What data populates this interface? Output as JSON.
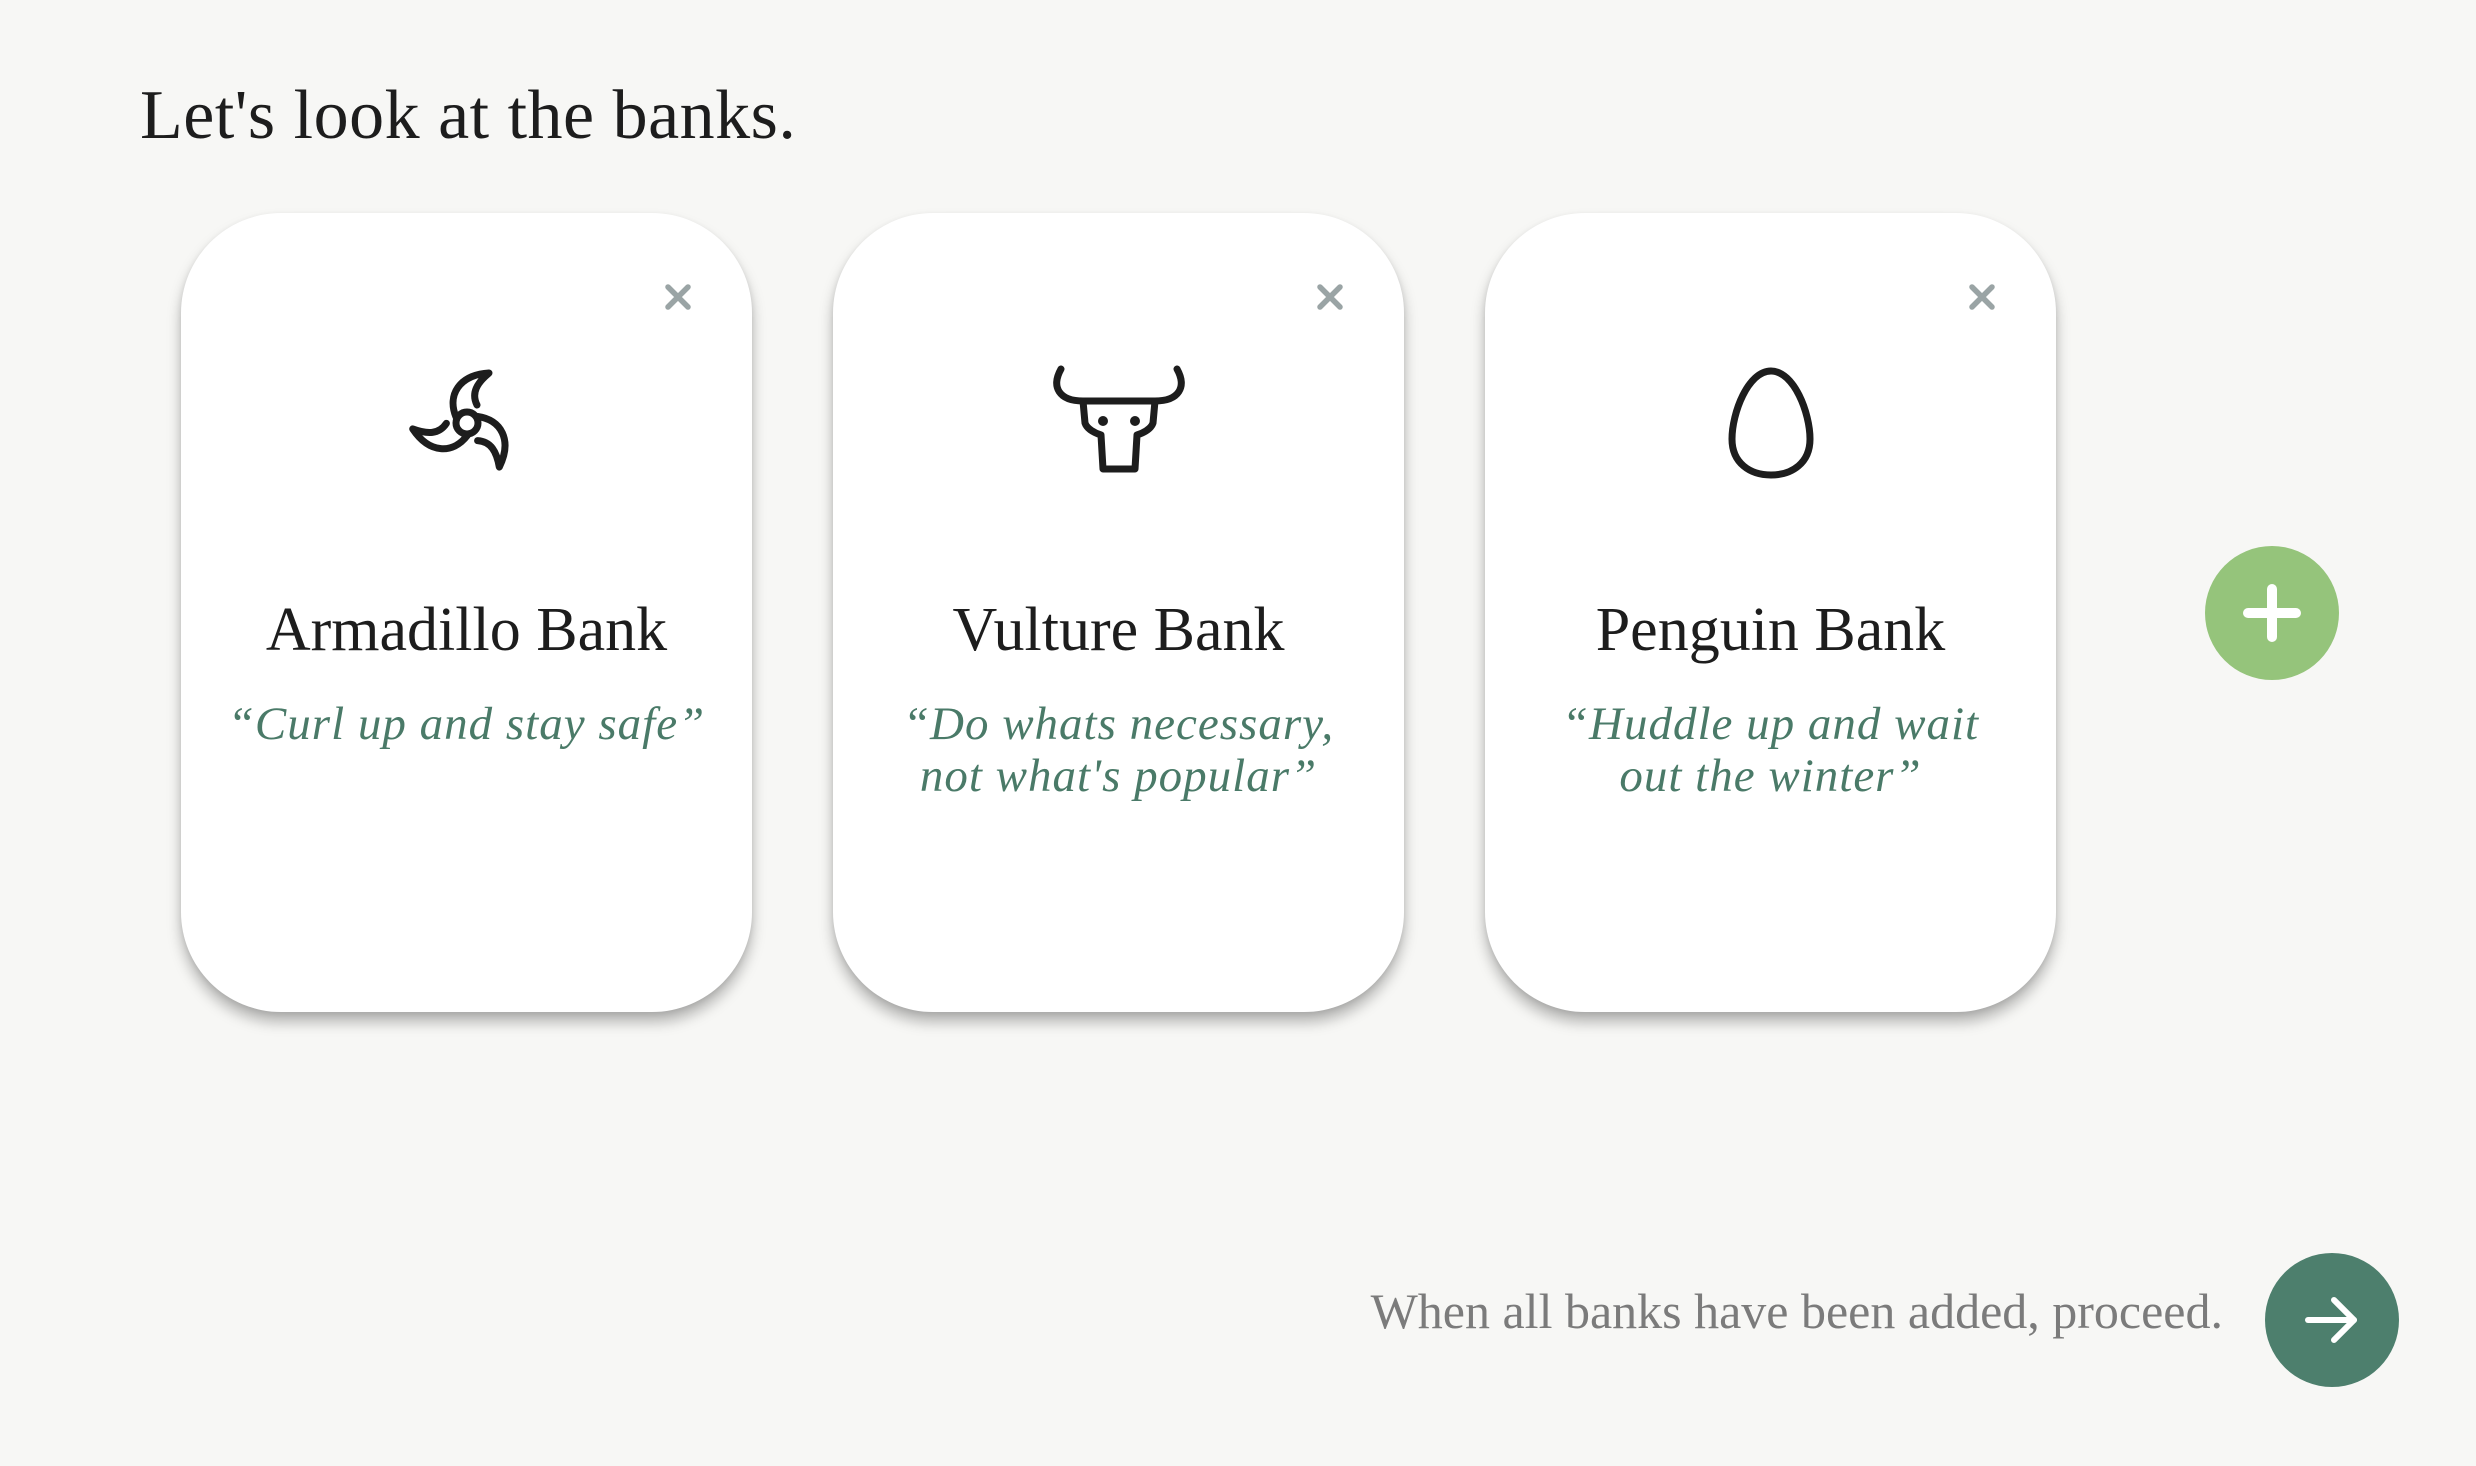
{
  "page": {
    "title": "Let's look at the banks."
  },
  "banks": [
    {
      "name": "Armadillo Bank",
      "motto": "“Curl up and stay safe”",
      "icon": "pinwheel-icon",
      "close_icon": "close-icon"
    },
    {
      "name": "Vulture Bank",
      "motto": "“Do whats necessary, not what's popular”",
      "icon": "bull-skull-icon",
      "close_icon": "close-icon"
    },
    {
      "name": "Penguin Bank",
      "motto": "“Huddle up and wait out the winter”",
      "icon": "egg-icon",
      "close_icon": "close-icon"
    }
  ],
  "add_button": {
    "icon": "plus-icon",
    "color": "#95c47b"
  },
  "footer": {
    "hint": "When all banks have been added, proceed.",
    "next_icon": "arrow-right-icon",
    "next_color": "#4d7f6d"
  },
  "colors": {
    "background": "#f7f7f5",
    "card": "#ffffff",
    "motto": "#4a7a68",
    "close": "#9aa4a5"
  }
}
